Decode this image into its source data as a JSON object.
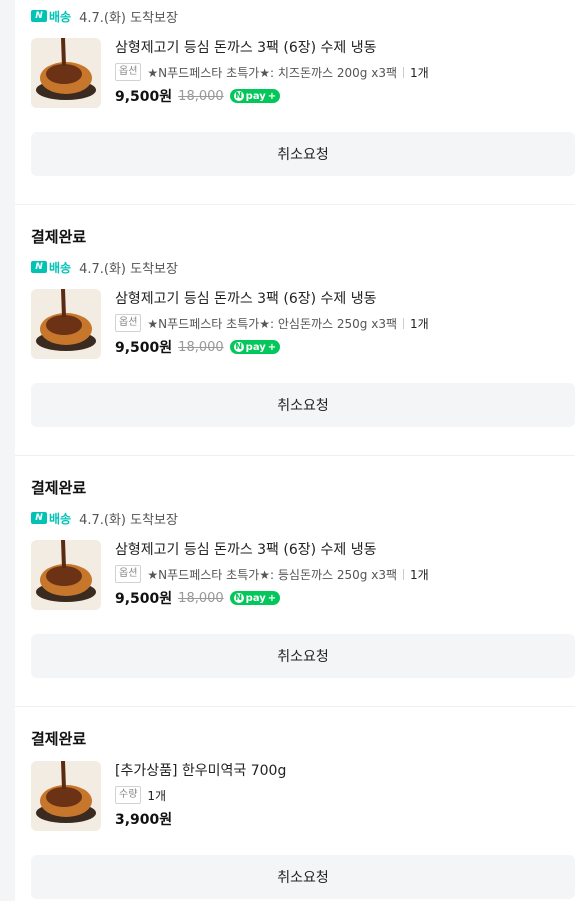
{
  "orders": [
    {
      "status": "",
      "delivery_badge": "배송",
      "delivery_date": "4.7.(화) 도착보장",
      "title": "삼형제고기 등심 돈까스 3팩 (6장) 수제 냉동",
      "option_tag": "옵션",
      "option_text": "★N푸드페스타 초특가★: 치즈돈까스 200g x3팩",
      "qty": "1개",
      "price": "9,500원",
      "original_price": "18,000",
      "npay": "pay",
      "cancel_label": "취소요청"
    },
    {
      "status": "결제완료",
      "delivery_badge": "배송",
      "delivery_date": "4.7.(화) 도착보장",
      "title": "삼형제고기 등심 돈까스 3팩 (6장) 수제 냉동",
      "option_tag": "옵션",
      "option_text": "★N푸드페스타 초특가★: 안심돈까스 250g x3팩",
      "qty": "1개",
      "price": "9,500원",
      "original_price": "18,000",
      "npay": "pay",
      "cancel_label": "취소요청"
    },
    {
      "status": "결제완료",
      "delivery_badge": "배송",
      "delivery_date": "4.7.(화) 도착보장",
      "title": "삼형제고기 등심 돈까스 3팩 (6장) 수제 냉동",
      "option_tag": "옵션",
      "option_text": "★N푸드페스타 초특가★: 등심돈까스 250g x3팩",
      "qty": "1개",
      "price": "9,500원",
      "original_price": "18,000",
      "npay": "pay",
      "cancel_label": "취소요청"
    },
    {
      "status": "결제완료",
      "title": "[추가상품] 한우미역국 700g",
      "option_tag": "수량",
      "qty": "1개",
      "price": "3,900원",
      "cancel_label": "취소요청"
    }
  ],
  "colors": {
    "naver_green": "#03c75a",
    "delivery_teal": "#00c3b6"
  }
}
